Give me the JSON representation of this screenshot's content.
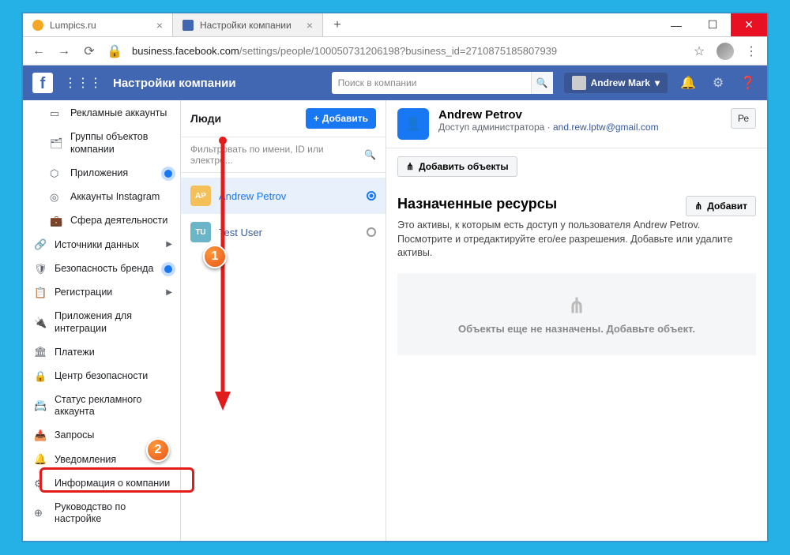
{
  "browser": {
    "tab1_title": "Lumpics.ru",
    "tab2_title": "Настройки компании",
    "url_host": "business.facebook.com",
    "url_path": "/settings/people/100050731206198?business_id=2710875185807939"
  },
  "fbbar": {
    "title": "Настройки компании",
    "search_placeholder": "Поиск в компании",
    "username": "Andrew Mark"
  },
  "sidebar": {
    "items": [
      {
        "label": "Рекламные аккаунты",
        "indent": true
      },
      {
        "label": "Группы объектов компании",
        "indent": true
      },
      {
        "label": "Приложения",
        "indent": true,
        "dot": true
      },
      {
        "label": "Аккаунты Instagram",
        "indent": true
      },
      {
        "label": "Сфера деятельности",
        "indent": true
      },
      {
        "label": "Источники данных",
        "chev": true
      },
      {
        "label": "Безопасность бренда",
        "chev": true,
        "dot": true
      },
      {
        "label": "Регистрации",
        "chev": true
      },
      {
        "label": "Приложения для интеграции"
      },
      {
        "label": "Платежи"
      },
      {
        "label": "Центр безопасности"
      },
      {
        "label": "Статус рекламного аккаунта"
      },
      {
        "label": "Запросы"
      },
      {
        "label": "Уведомления"
      },
      {
        "label": "Информация о компании"
      },
      {
        "label": "Руководство по настройке"
      }
    ]
  },
  "middle": {
    "title": "Люди",
    "add_label": "Добавить",
    "filter_placeholder": "Фильтровать по имени, ID или электро...",
    "people": [
      {
        "initials": "AP",
        "name": "Andrew Petrov",
        "selected": true,
        "color": "#f3c05a"
      },
      {
        "initials": "TU",
        "name": "Test User",
        "selected": false,
        "color": "#6bb5c9"
      }
    ]
  },
  "right": {
    "name": "Andrew Petrov",
    "role": "Доступ администратора",
    "email": "and.rew.lptw@gmail.com",
    "re_btn": "Ре",
    "add_objects": "Добавить объекты",
    "section_title": "Назначенные ресурсы",
    "add2": "Добавит",
    "desc": "Это активы, к которым есть доступ у пользователя Andrew Petrov. Посмотрите и отредактируйте его/ее разрешения. Добавьте или удалите активы.",
    "empty": "Объекты еще не назначены. Добавьте объект."
  },
  "callouts": {
    "c1": "1",
    "c2": "2"
  }
}
